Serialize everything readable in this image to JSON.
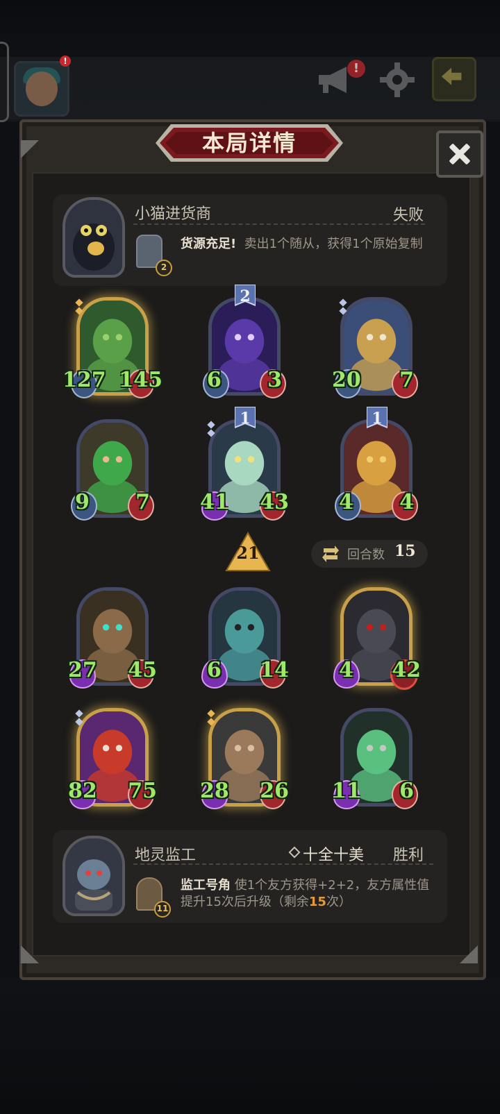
{
  "top_bar": {
    "notify_mark": "!"
  },
  "panel": {
    "title": "本局详情"
  },
  "opponent": {
    "name": "小猫进货商",
    "result": "失败",
    "skill_name": "货源充足!",
    "skill_desc": "卖出1个随从，获得1个原始复制",
    "skill_badge": "2"
  },
  "opponent_board": [
    {
      "atk": "127",
      "hp": "145",
      "style": "gold",
      "level": "",
      "art": "tree-spirit"
    },
    {
      "atk": "6",
      "hp": "3",
      "style": "normal",
      "level": "2",
      "art": "cosmic-beast"
    },
    {
      "atk": "20",
      "hp": "7",
      "style": "normal",
      "level": "",
      "art": "dwarf-king"
    },
    {
      "atk": "9",
      "hp": "7",
      "style": "normal",
      "level": "",
      "art": "green-hair-elf"
    },
    {
      "atk": "41",
      "hp": "43",
      "style": "normal",
      "level": "1",
      "art": "ghost-steed"
    },
    {
      "atk": "4",
      "hp": "4",
      "style": "normal",
      "level": "1",
      "art": "golden-paladin"
    }
  ],
  "round_info": {
    "tier_value": "21",
    "turns_label": "回合数",
    "turns_value": "15"
  },
  "player_board": [
    {
      "atk": "27",
      "hp": "45",
      "style": "normal",
      "art": "treant"
    },
    {
      "atk": "6",
      "hp": "14",
      "style": "normal",
      "art": "diver-ogre"
    },
    {
      "atk": "4",
      "hp": "42",
      "style": "gold",
      "art": "shadow-knight"
    },
    {
      "atk": "82",
      "hp": "75",
      "style": "gold-pink",
      "art": "red-dragon"
    },
    {
      "atk": "28",
      "hp": "26",
      "style": "gold",
      "art": "spear-kid"
    },
    {
      "atk": "11",
      "hp": "6",
      "style": "normal",
      "art": "bone-warrior"
    }
  ],
  "player": {
    "name": "地灵监工",
    "rank_label": "十全十美",
    "result": "胜利",
    "skill_name": "监工号角",
    "skill_desc_1": "使1个友方获得+2+2，友方属性值提升15次后升级（剩余",
    "skill_remaining": "15",
    "skill_desc_2": "次）",
    "skill_badge": "11"
  },
  "colors": {
    "stat_text": "#9fe86a",
    "gold_frame": "#c9a04a",
    "normal_frame": "#444a66",
    "banner_red": "#7a1a1e"
  }
}
